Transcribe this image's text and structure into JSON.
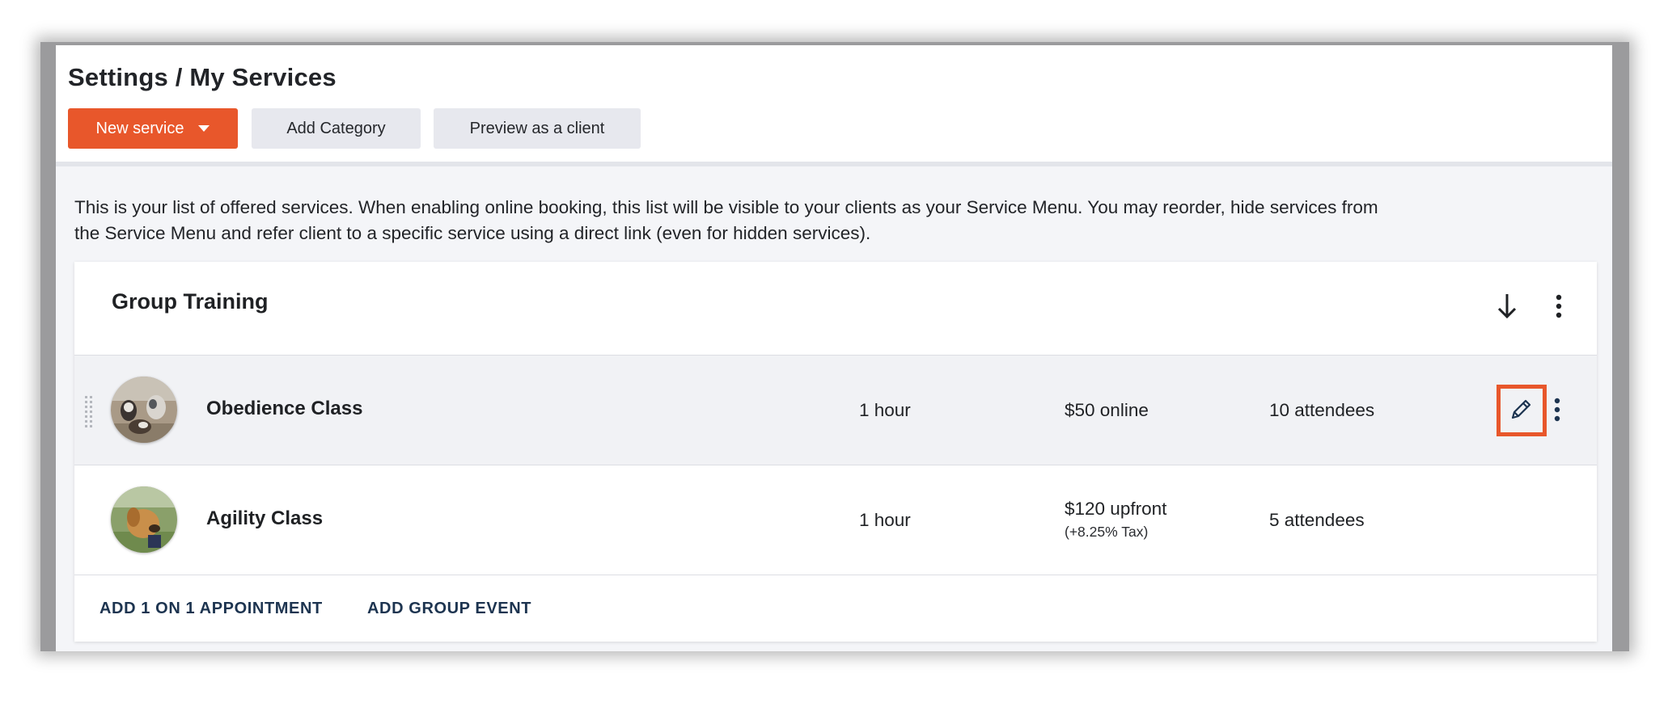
{
  "header": {
    "title": "Settings / My Services",
    "new_service_label": "New service",
    "add_category_label": "Add Category",
    "preview_label": "Preview as a client"
  },
  "intro_text": "This is your list of offered services. When enabling online booking, this list will be visible to your clients as your Service Menu. You may reorder, hide services from the Service Menu and refer client to a specific service using a direct link (even for hidden services).",
  "category": {
    "title": "Group Training",
    "services": [
      {
        "name": "Obedience Class",
        "duration": "1 hour",
        "price": "$50 online",
        "tax": "",
        "attendees": "10 attendees",
        "avatar_icon": "dogs-photo"
      },
      {
        "name": "Agility Class",
        "duration": "1 hour",
        "price": "$120 upfront",
        "tax": "(+8.25% Tax)",
        "attendees": "5 attendees",
        "avatar_icon": "dog-photo"
      }
    ],
    "footer_links": [
      "ADD 1 ON 1 APPOINTMENT",
      "ADD GROUP EVENT"
    ]
  },
  "colors": {
    "accent": "#e8572b",
    "secondary_button": "#e7e8ee",
    "link": "#1d3450",
    "highlight_row": "#f1f2f5"
  },
  "icons": {
    "new_service_caret": "caret-down-icon",
    "sort": "arrow-down-icon",
    "category_menu": "kebab-icon",
    "row_drag": "drag-handle-icon",
    "row_edit": "pencil-icon",
    "row_menu": "kebab-icon"
  }
}
